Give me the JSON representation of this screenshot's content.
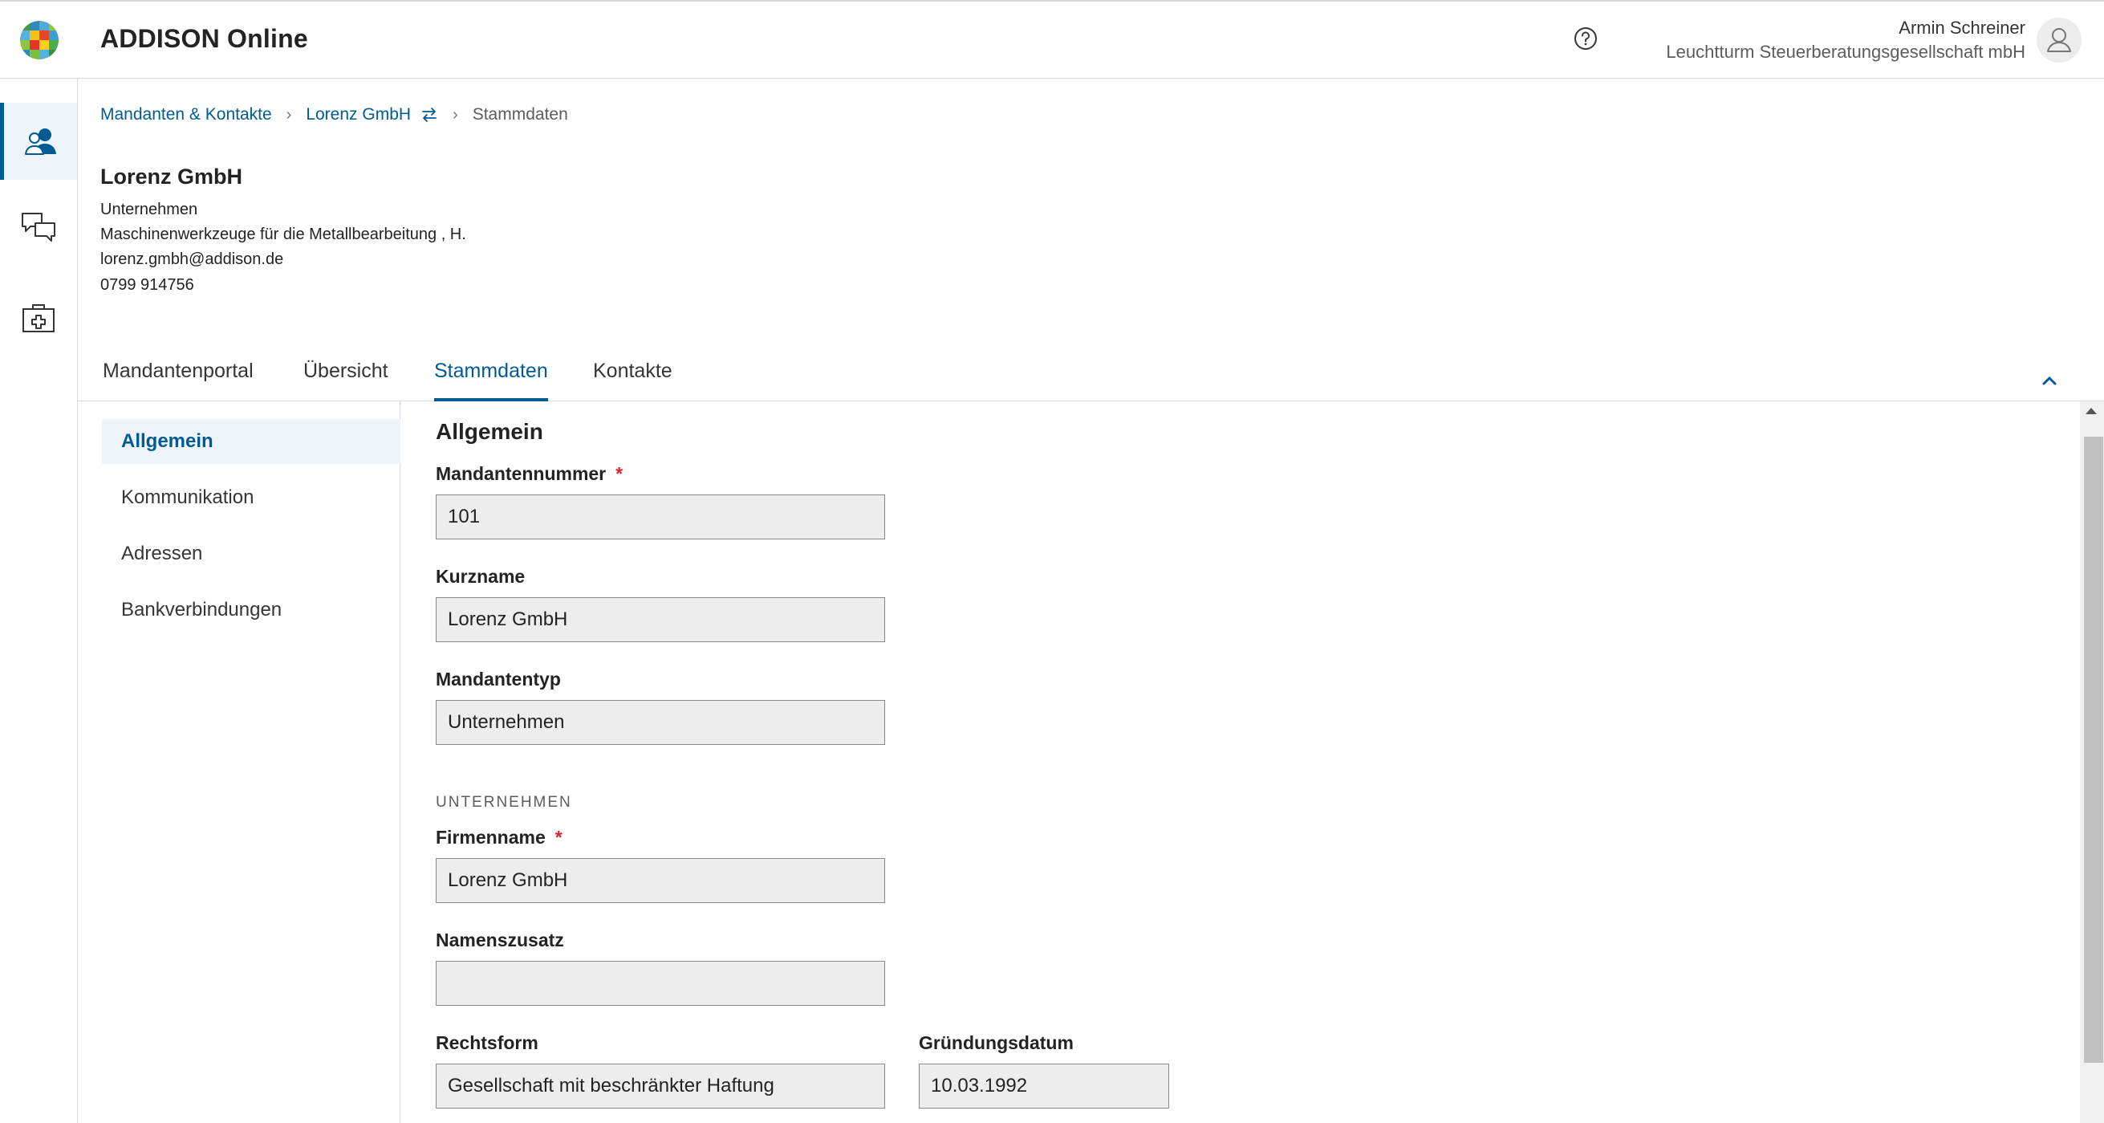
{
  "app": {
    "title": "ADDISON Online"
  },
  "user": {
    "name": "Armin Schreiner",
    "organization": "Leuchtturm Steuerberatungsgesellschaft mbH"
  },
  "rail": {
    "items": [
      {
        "icon": "clients-icon",
        "active": true
      },
      {
        "icon": "chat-icon",
        "active": false
      },
      {
        "icon": "first-aid-kit-icon",
        "active": false
      }
    ]
  },
  "breadcrumb": {
    "root": "Mandanten & Kontakte",
    "client": "Lorenz GmbH",
    "current": "Stammdaten"
  },
  "client": {
    "name": "Lorenz GmbH",
    "type": "Unternehmen",
    "industry": "Maschinenwerkzeuge für die Metallbearbeitung , H.",
    "email": "lorenz.gmbh@addison.de",
    "phone": "0799 914756"
  },
  "tabs": [
    {
      "label": "Mandantenportal"
    },
    {
      "label": "Übersicht"
    },
    {
      "label": "Stammdaten",
      "active": true
    },
    {
      "label": "Kontakte"
    }
  ],
  "subnav": [
    {
      "label": "Allgemein",
      "active": true
    },
    {
      "label": "Kommunikation"
    },
    {
      "label": "Adressen"
    },
    {
      "label": "Bankverbindungen"
    }
  ],
  "form": {
    "title": "Allgemein",
    "mandantennummer": {
      "label": "Mandantennummer",
      "required_mark": "*",
      "value": "101"
    },
    "kurzname": {
      "label": "Kurzname",
      "value": "Lorenz GmbH"
    },
    "mandantentyp": {
      "label": "Mandantentyp",
      "value": "Unternehmen"
    },
    "section_unternehmen": "UNTERNEHMEN",
    "firmenname": {
      "label": "Firmenname",
      "required_mark": "*",
      "value": "Lorenz GmbH"
    },
    "namenszusatz": {
      "label": "Namenszusatz",
      "value": ""
    },
    "rechtsform": {
      "label": "Rechtsform",
      "value": "Gesellschaft mit beschränkter Haftung"
    },
    "gruendungsdatum": {
      "label": "Gründungsdatum",
      "value": "10.03.1992"
    }
  },
  "colors": {
    "accent": "#005b92",
    "required": "#e5202e",
    "input_bg": "#ededed"
  }
}
